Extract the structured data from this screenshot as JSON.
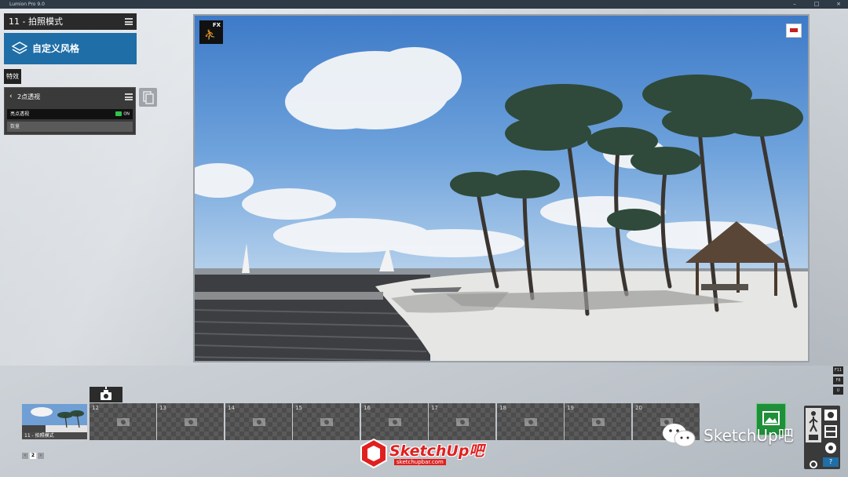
{
  "window": {
    "title": "Lumion Pro 9.0",
    "controls": [
      "–",
      "□",
      "×"
    ]
  },
  "left_panel": {
    "mode_title": "11 - 拍照模式",
    "style_button_label": "自定义风格",
    "effects_tab": "特效",
    "effect": {
      "name": "2点透视",
      "property_label": "亮点透视",
      "toggle_state": "ON",
      "amount_label": "数量"
    }
  },
  "viewport": {
    "fx_label": "FX"
  },
  "function_keys": [
    "F11",
    "F8",
    "U"
  ],
  "photo_slots": [
    {
      "number": "",
      "caption": "11 - 拍照模式",
      "active": true
    },
    {
      "number": "12",
      "active": false
    },
    {
      "number": "13",
      "active": false
    },
    {
      "number": "14",
      "active": false
    },
    {
      "number": "15",
      "active": false
    },
    {
      "number": "16",
      "active": false
    },
    {
      "number": "17",
      "active": false
    },
    {
      "number": "18",
      "active": false
    },
    {
      "number": "19",
      "active": false
    },
    {
      "number": "20",
      "active": false
    }
  ],
  "pager": {
    "prev": "‹",
    "current": "2",
    "next": "›"
  },
  "tool_stack": {
    "help_label": "?"
  },
  "watermark": {
    "wechat_text": "SketchUp吧",
    "logo_name": "SketchUp吧",
    "logo_url": "sketchupbar.com"
  },
  "colors": {
    "accent_blue": "#1f6ea7",
    "toggle_green": "#31c44b",
    "render_green": "#1f8f3a",
    "logo_red": "#e0201f"
  }
}
